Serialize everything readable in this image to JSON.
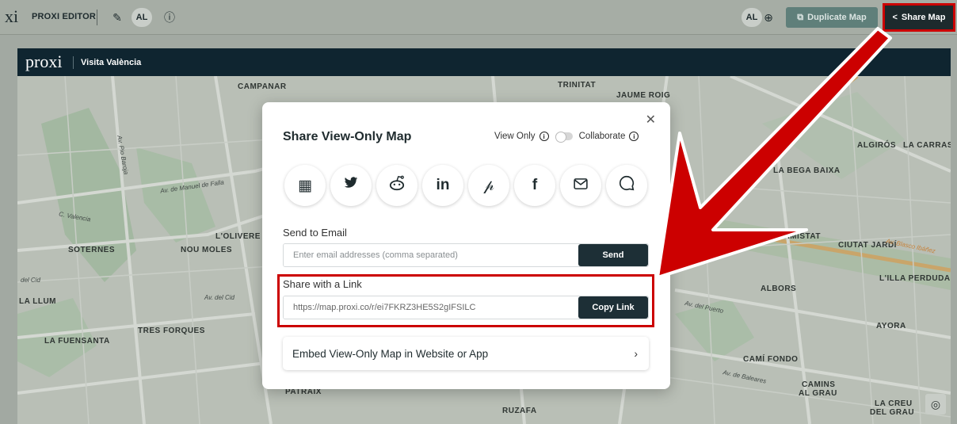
{
  "topbar": {
    "logo_fragment": "xi",
    "editor_label": "PROXI EDITOR",
    "user_initials": "AL",
    "right_user_initials": "AL",
    "duplicate_label": "Duplicate Map",
    "share_label": "Share Map"
  },
  "map": {
    "logo": "proxi",
    "site_name": "Visita València",
    "labels": [
      {
        "text": "CAMPANAR",
        "cls": "big"
      },
      {
        "text": "TRINITAT",
        "cls": "big"
      },
      {
        "text": "JAUME ROIG",
        "cls": "big"
      },
      {
        "text": "ALGIRÓS",
        "cls": "big"
      },
      {
        "text": "LA CARRAS",
        "cls": "big"
      },
      {
        "text": "LA BEGA BAIXA",
        "cls": "big"
      },
      {
        "text": "L'OLIVERE",
        "cls": "big"
      },
      {
        "text": "SOTERNES",
        "cls": "big"
      },
      {
        "text": "NOU MOLES",
        "cls": "big"
      },
      {
        "text": "L'AMISTAT",
        "cls": "big"
      },
      {
        "text": "CIUTAT JARDÍ",
        "cls": "big"
      },
      {
        "text": "L'ILLA PERDUDA",
        "cls": "big"
      },
      {
        "text": "LA LLUM",
        "cls": "big"
      },
      {
        "text": "ALBORS",
        "cls": "big"
      },
      {
        "text": "TRES FORQUES",
        "cls": "big"
      },
      {
        "text": "LA FUENSANTA",
        "cls": "big"
      },
      {
        "text": "AYORA",
        "cls": "big"
      },
      {
        "text": "CAMÍ FONDO",
        "cls": "big"
      },
      {
        "text": "CAMINS",
        "cls": "big"
      },
      {
        "text": "AL GRAU",
        "cls": "big"
      },
      {
        "text": "LA CREU",
        "cls": "big"
      },
      {
        "text": "DEL GRAU",
        "cls": "big"
      },
      {
        "text": "RUZAFA",
        "cls": "big"
      },
      {
        "text": "PATRAIX",
        "cls": "big"
      },
      {
        "text": "Av. de Manuel de Falla",
        "cls": "street"
      },
      {
        "text": "Av. Pio Baroja",
        "cls": "street"
      },
      {
        "text": "Av. del Cid",
        "cls": "street"
      },
      {
        "text": "Av. del Puerto",
        "cls": "street"
      },
      {
        "text": "Av. de Baleares",
        "cls": "street"
      },
      {
        "text": "Av. Blasco Ibáñez",
        "cls": "street"
      },
      {
        "text": "C. Valencia",
        "cls": "street"
      },
      {
        "text": "del Cid",
        "cls": "street"
      }
    ]
  },
  "modal": {
    "title": "Share View-Only Map",
    "view_only_label": "View Only",
    "collaborate_label": "Collaborate",
    "email_section_label": "Send to Email",
    "email_placeholder": "Enter email addresses (comma separated)",
    "send_label": "Send",
    "link_section_label": "Share with a Link",
    "link_value": "https://map.proxi.co/r/ei7FKRZ3HE5S2gIFSILC",
    "copy_label": "Copy Link",
    "embed_label": "Embed View-Only Map in Website or App",
    "social": [
      {
        "name": "qr-code-icon",
        "glyph": "▦"
      },
      {
        "name": "twitter-icon",
        "glyph": "🐦"
      },
      {
        "name": "reddit-icon",
        "glyph": "◉"
      },
      {
        "name": "linkedin-icon",
        "glyph": "in"
      },
      {
        "name": "pinterest-icon",
        "glyph": "P"
      },
      {
        "name": "facebook-icon",
        "glyph": "f"
      },
      {
        "name": "mail-icon",
        "glyph": "✉"
      },
      {
        "name": "chat-icon",
        "glyph": "◯"
      }
    ]
  },
  "colors": {
    "accent_dark": "#1d2f36",
    "highlight_red": "#cc0000",
    "duplicate_teal": "#5f7f7a"
  }
}
